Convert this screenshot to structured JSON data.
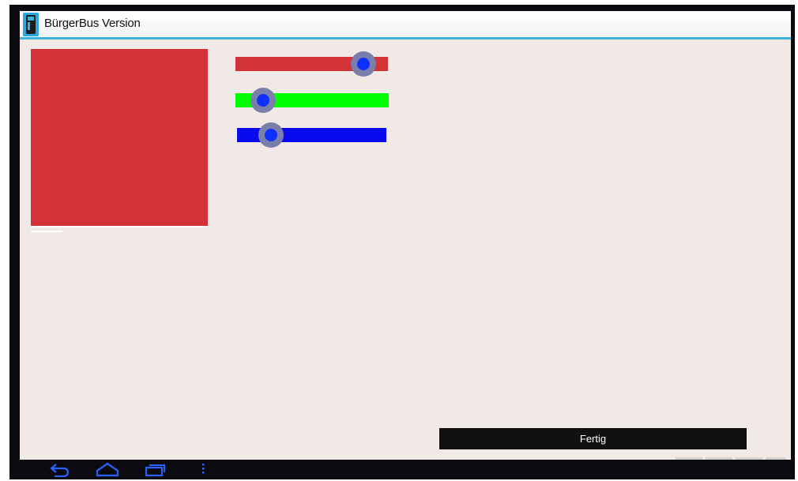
{
  "window": {
    "title": "BürgerBus Version",
    "accent_color": "#3ab4de"
  },
  "preview": {
    "color": "#d23238"
  },
  "sliders": [
    {
      "channel": "red",
      "track_color": "#d23238",
      "value": 0.84
    },
    {
      "channel": "green",
      "track_color": "#00ff00",
      "value": 0.18
    },
    {
      "channel": "blue",
      "track_color": "#0a0aee",
      "value": 0.23
    }
  ],
  "actions": {
    "done_label": "Fertig"
  },
  "navbar": {
    "icons": [
      "back-icon",
      "home-icon",
      "recent-apps-icon",
      "menu-icon"
    ],
    "icon_color": "#2a62ff"
  }
}
